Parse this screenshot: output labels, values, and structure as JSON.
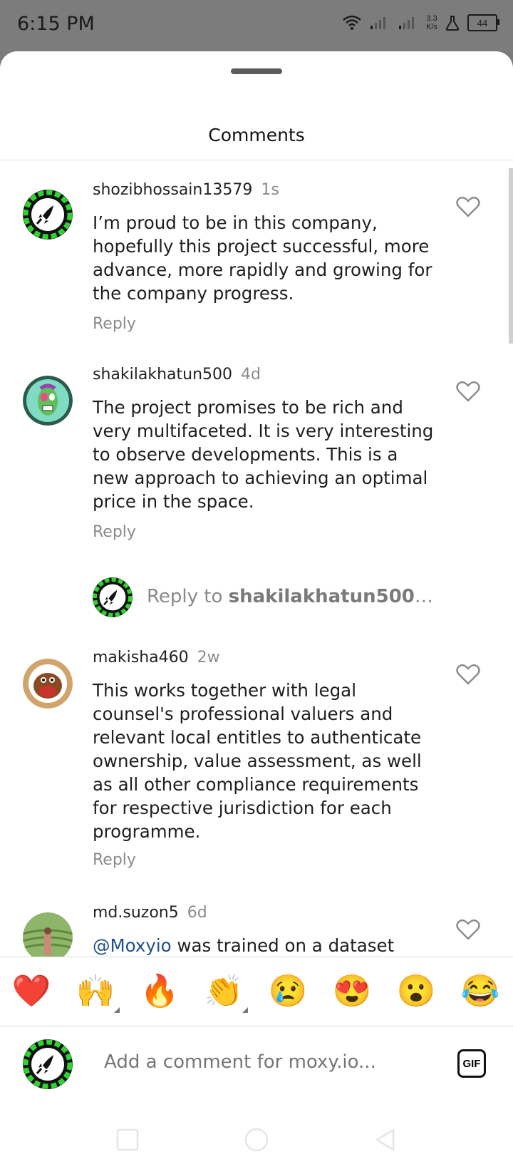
{
  "status_bar": {
    "time": "6:15 PM",
    "net_speed_value": "3.3",
    "net_speed_unit": "K/s",
    "battery": "44"
  },
  "sheet": {
    "title": "Comments"
  },
  "comments": [
    {
      "username": "shozibhossain13579",
      "time": "1s",
      "text": "I’m proud to be in this company, hopefully this project successful, more advance, more rapidly and growing for the company progress.",
      "reply_label": "Reply"
    },
    {
      "username": "shakilakhatun500",
      "time": "4d",
      "text": "The project promises to be rich and very multifaceted. It is very interesting to observe developments. This is a new approach to achieving an optimal price in the space.",
      "reply_label": "Reply"
    },
    {
      "username": "makisha460",
      "time": "2w",
      "text": "This works  together with legal counsel's  professional valuers and relevant local entitles to  authenticate ownership, value assessment, as well as all other compliance requirements for respective jurisdiction for each programme.",
      "reply_label": "Reply"
    },
    {
      "username": "md.suzon5",
      "time": "6d",
      "mention": "@Moxyio",
      "text": " was trained on a dataset"
    }
  ],
  "reply_prompt": {
    "prefix": "Reply to ",
    "username": "shakilakhatun500",
    "suffix": "…"
  },
  "emoji_bar": [
    "❤️",
    "🙌",
    "🔥",
    "👏",
    "😢",
    "😍",
    "😮",
    "😂"
  ],
  "composer": {
    "placeholder": "Add a comment for moxy.io...",
    "gif_label": "GIF"
  },
  "colors": {
    "mention": "#1f4f8a",
    "rocket_avatar_green": "#2fd52f"
  }
}
